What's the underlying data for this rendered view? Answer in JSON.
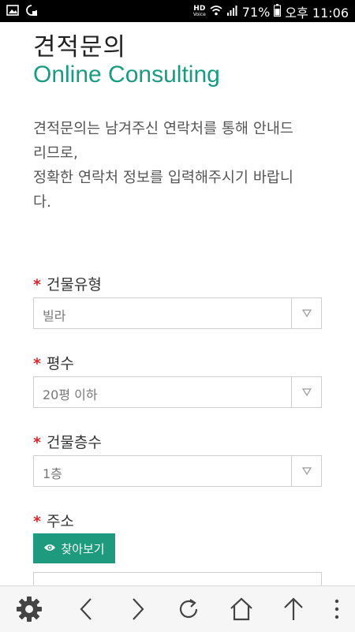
{
  "status_bar": {
    "hd_label": "HD",
    "hd_sub": "Voice",
    "battery_percent": "71%",
    "time": "오후 11:06"
  },
  "page": {
    "title_ko": "견적문의",
    "title_en": "Online Consulting",
    "intro_lines": [
      "견적문의는 남겨주신 연락처를 통해 안내드",
      "리므로,",
      "정확한 연락처 정보를 입력해주시기 바랍니",
      "다."
    ]
  },
  "form": {
    "required_mark": "*",
    "building_type": {
      "label": "건물유형",
      "value": "빌라"
    },
    "area": {
      "label": "평수",
      "value": "20평 이하"
    },
    "floors": {
      "label": "건물층수",
      "value": "1층"
    },
    "address": {
      "label": "주소",
      "search_button": "찾아보기",
      "value": ""
    }
  },
  "colors": {
    "accent": "#179b83",
    "button": "#1e9b7f",
    "required": "#e0242b"
  },
  "toolbar": {
    "icons": [
      "gear-icon",
      "back-icon",
      "forward-icon",
      "refresh-icon",
      "home-icon",
      "scroll-top-icon",
      "more-icon"
    ]
  }
}
